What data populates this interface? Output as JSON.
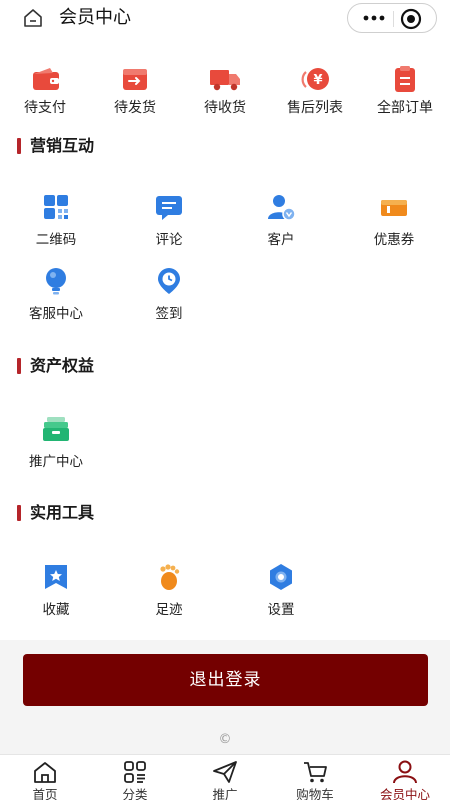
{
  "header": {
    "title": "会员中心",
    "home_icon": "home-icon",
    "more_icon": "more-dots-icon",
    "target_icon": "target-icon"
  },
  "orders": [
    {
      "label": "待支付",
      "icon": "wallet-icon"
    },
    {
      "label": "待发货",
      "icon": "box-export-icon"
    },
    {
      "label": "待收货",
      "icon": "truck-icon"
    },
    {
      "label": "售后列表",
      "icon": "yen-refund-icon"
    },
    {
      "label": "全部订单",
      "icon": "clipboard-icon"
    }
  ],
  "sections": [
    {
      "title": "营销互动",
      "items": [
        {
          "label": "二维码",
          "icon": "qrcode-icon"
        },
        {
          "label": "评论",
          "icon": "comment-icon"
        },
        {
          "label": "客户",
          "icon": "customer-icon"
        },
        {
          "label": "优惠券",
          "icon": "coupon-icon"
        },
        {
          "label": "客服中心",
          "icon": "service-bulb-icon"
        },
        {
          "label": "签到",
          "icon": "checkin-clock-icon"
        }
      ]
    },
    {
      "title": "资产权益",
      "items": [
        {
          "label": "推广中心",
          "icon": "promotion-tray-icon"
        }
      ]
    },
    {
      "title": "实用工具",
      "items": [
        {
          "label": "收藏",
          "icon": "favorite-star-icon"
        },
        {
          "label": "足迹",
          "icon": "footprint-icon"
        },
        {
          "label": "设置",
          "icon": "settings-gear-icon"
        }
      ]
    }
  ],
  "logout": {
    "label": "退出登录"
  },
  "copyright": "©",
  "tabbar": [
    {
      "label": "首页",
      "icon": "home-icon",
      "active": false
    },
    {
      "label": "分类",
      "icon": "category-icon",
      "active": false
    },
    {
      "label": "推广",
      "icon": "send-icon",
      "active": false
    },
    {
      "label": "购物车",
      "icon": "cart-icon",
      "active": false
    },
    {
      "label": "会员中心",
      "icon": "user-icon",
      "active": true
    }
  ],
  "colors": {
    "brand_red": "#e84a3c",
    "logout_bg": "#740000",
    "section_bar": "#b5252a",
    "active_tab": "#8a0f12",
    "icon_blue": "#2f7de1"
  }
}
